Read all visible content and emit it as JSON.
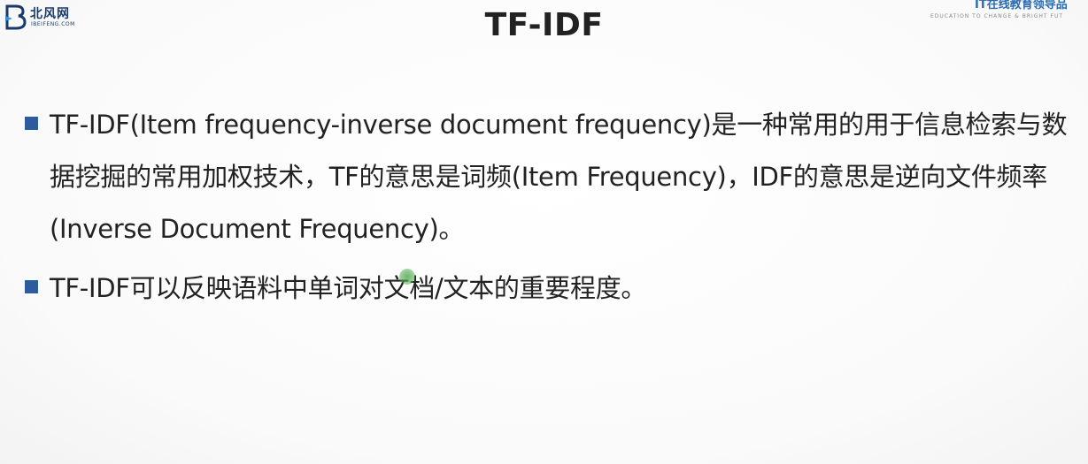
{
  "logo": {
    "name": "北风网",
    "sub": "IBEIFENG.COM"
  },
  "brand": {
    "name": "IT在线教育领导品",
    "sub": "EDUCATION TO CHANGE & BRIGHT FUT"
  },
  "slide": {
    "title": "TF-IDF",
    "bullets": [
      {
        "text": "TF-IDF(Item frequency-inverse document frequency)是一种常用的用于信息检索与数据挖掘的常用加权技术，TF的意思是词频(Item Frequency)，IDF的意思是逆向文件频率(Inverse Document Frequency)。"
      },
      {
        "text": "TF-IDF可以反映语料中单词对文档/文本的重要程度。"
      }
    ]
  },
  "colors": {
    "bullet": "#2e5a9e",
    "title": "#222222",
    "logo": "#1a3a6b",
    "brand": "#2b6cb0"
  }
}
